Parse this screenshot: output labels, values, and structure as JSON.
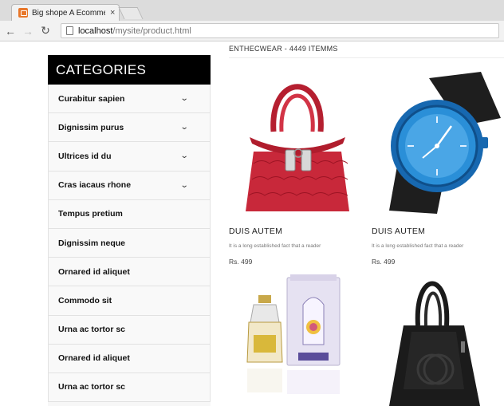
{
  "browser": {
    "tab_title": "Big shope A Ecommerce",
    "tab_close": "×",
    "url_host": "localhost",
    "url_path": "/mysite/product.html"
  },
  "sidebar": {
    "title": "CATEGORIES",
    "items": [
      {
        "label": "Curabitur sapien",
        "chevron": "⌄"
      },
      {
        "label": "Dignissim purus",
        "chevron": "⌄"
      },
      {
        "label": "Ultrices id du",
        "chevron": "⌄"
      },
      {
        "label": "Cras iacaus rhone",
        "chevron": "⌄"
      },
      {
        "label": "Tempus pretium",
        "chevron": ""
      },
      {
        "label": "Dignissim neque",
        "chevron": ""
      },
      {
        "label": "Ornared id aliquet",
        "chevron": ""
      },
      {
        "label": "Commodo sit",
        "chevron": ""
      },
      {
        "label": "Urna ac tortor sc",
        "chevron": ""
      },
      {
        "label": "Ornared id aliquet",
        "chevron": ""
      },
      {
        "label": "Urna ac tortor sc",
        "chevron": ""
      }
    ]
  },
  "products": {
    "heading": "ENTHECWEAR - 4449 ITEMMS",
    "items": [
      {
        "title": "DUIS AUTEM",
        "desc": "It is a long established fact that a reader",
        "price": "Rs. 499",
        "image": "red-handbag"
      },
      {
        "title": "DUIS AUTEM",
        "desc": "It is a long established fact that a reader",
        "price": "Rs. 499",
        "image": "blue-watch"
      },
      {
        "title": "",
        "desc": "",
        "price": "",
        "image": "perfume-bottle"
      },
      {
        "title": "",
        "desc": "",
        "price": "",
        "image": "black-handbag"
      }
    ]
  },
  "colors": {
    "header_bg": "#000000",
    "bag_red": "#c8283a",
    "watch_blue": "#2a8fd8"
  }
}
